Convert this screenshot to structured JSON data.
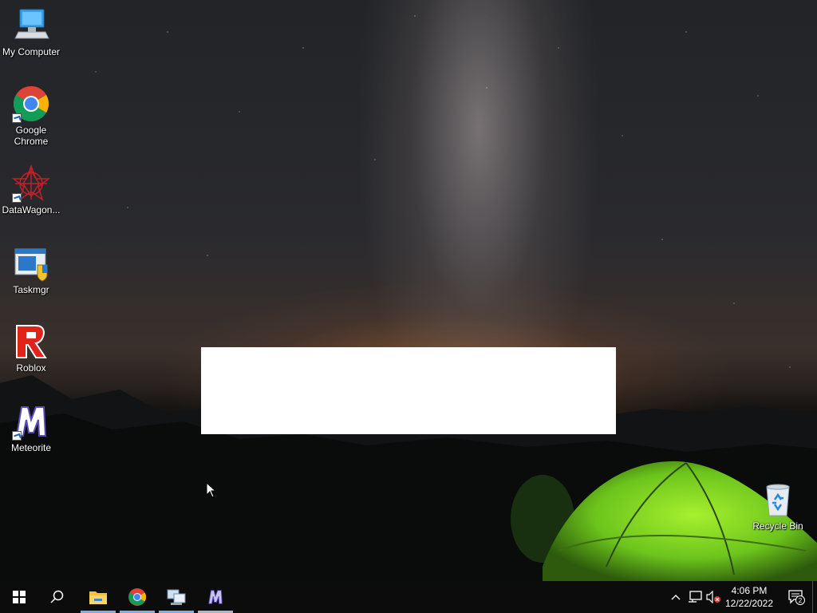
{
  "desktop": {
    "icons": [
      {
        "label": "My Computer",
        "icon": "computer-icon"
      },
      {
        "label": "Google Chrome",
        "icon": "chrome-icon",
        "shortcut": true
      },
      {
        "label": "DataWagon...",
        "icon": "datawagon-icon",
        "shortcut": true
      },
      {
        "label": "Taskmgr",
        "icon": "taskmgr-icon"
      },
      {
        "label": "Roblox",
        "icon": "roblox-icon"
      },
      {
        "label": "Meteorite",
        "icon": "meteorite-icon",
        "shortcut": true
      },
      {
        "label": "Recycle Bin",
        "icon": "recycle-bin-icon"
      }
    ],
    "wallpaper": "night-sky-milky-way-tent",
    "overlay_panel_color": "#ffffff"
  },
  "taskbar": {
    "start_icon": "windows-logo-icon",
    "search_icon": "search-icon",
    "pinned": [
      {
        "name": "File Explorer",
        "icon": "folder-icon",
        "running": true
      },
      {
        "name": "Google Chrome",
        "icon": "chrome-icon",
        "running": true
      },
      {
        "name": "Network App",
        "icon": "network-app-icon",
        "running": true
      },
      {
        "name": "Meteorite",
        "icon": "meteorite-icon",
        "running": true,
        "active": true
      }
    ],
    "tray": {
      "chevron_icon": "chevron-up-icon",
      "network_icon": "network-icon",
      "volume_icon": "volume-muted-icon"
    },
    "clock": {
      "time": "4:06 PM",
      "date": "12/22/2022"
    },
    "notifications": {
      "icon": "action-center-icon",
      "count": "2"
    }
  },
  "colors": {
    "taskbar_bg": "#0c0c0c",
    "running_indicator": "#7ab0e6",
    "tent_green": "#7ed321"
  }
}
